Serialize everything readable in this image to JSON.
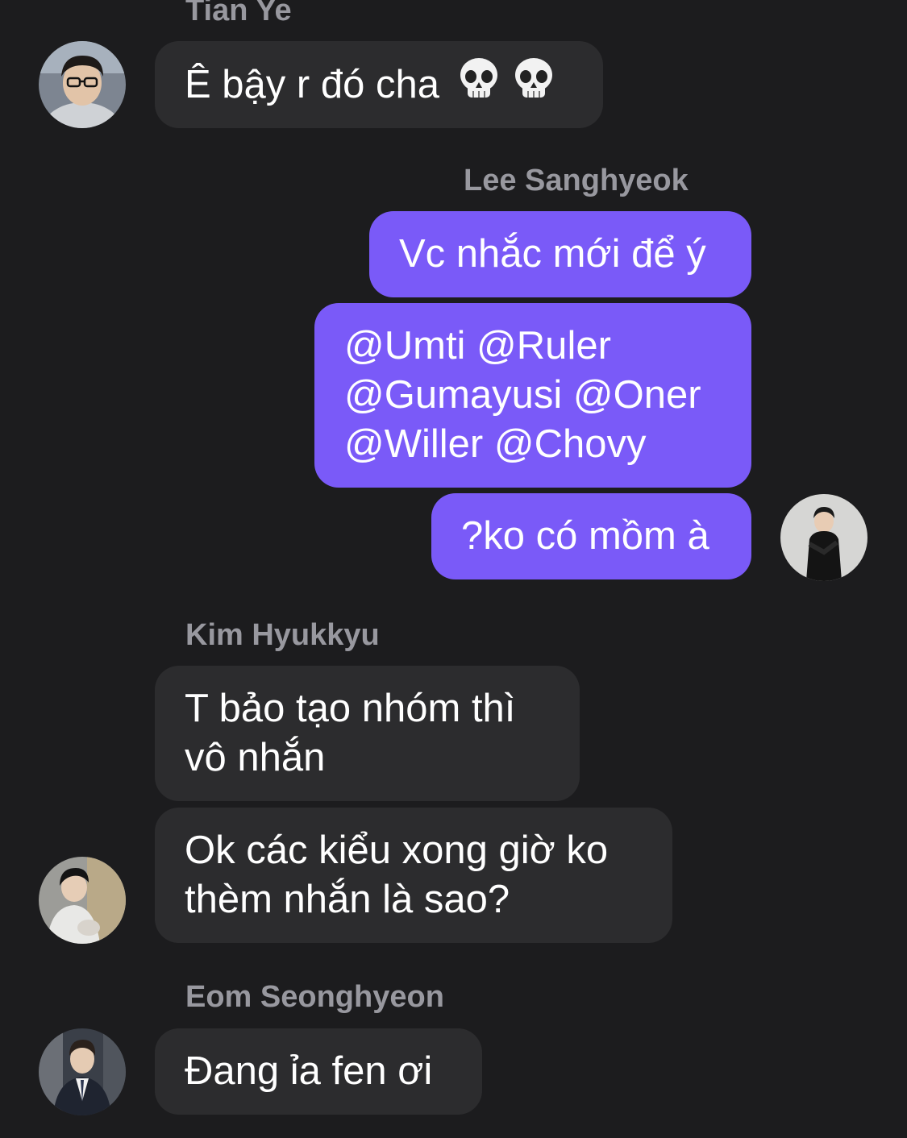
{
  "messages": {
    "m1": {
      "sender": "Tian Ye",
      "text": "Ê bậy r đó cha",
      "emoji": "skull-icon"
    },
    "m2": {
      "sender": "Lee Sanghyeok",
      "text": "Vc nhắc mới để ý"
    },
    "m3": {
      "lines": [
        "@Umti @Ruler",
        "@Gumayusi @Oner",
        "@Willer @Chovy"
      ]
    },
    "m4": {
      "text": "?ko có mồm à"
    },
    "m5": {
      "sender": "Kim Hyukkyu",
      "lines": [
        "T bảo tạo nhóm thì",
        "vô nhắn"
      ]
    },
    "m6": {
      "lines": [
        "Ok các kiểu xong giờ ko",
        "thèm nhắn là sao?"
      ]
    },
    "m7": {
      "sender": "Eom Seonghyeon",
      "text": "Đang ỉa fen ơi"
    }
  },
  "colors": {
    "background": "#1c1c1e",
    "incoming_bubble": "#2c2c2e",
    "outgoing_bubble": "#7a5af8",
    "sender_name": "#98989f"
  }
}
